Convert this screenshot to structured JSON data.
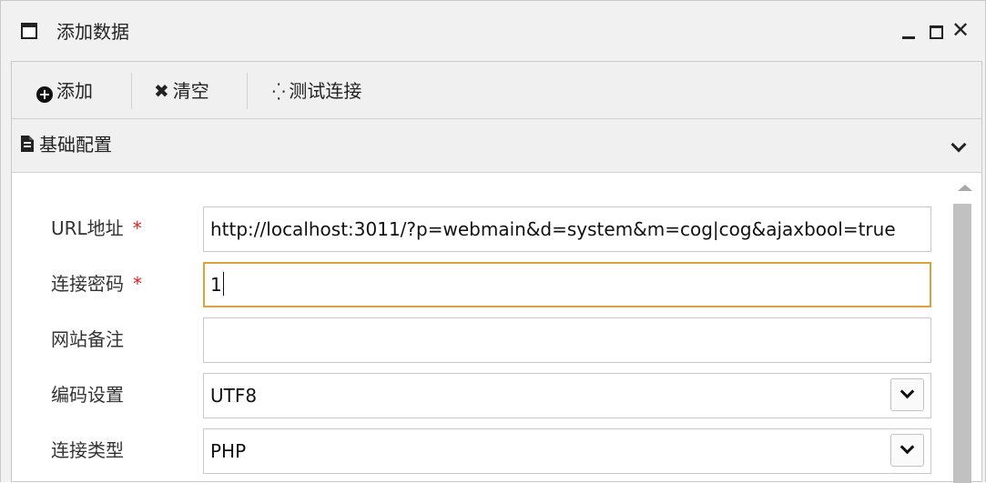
{
  "window": {
    "title": "添加数据"
  },
  "toolbar": {
    "add_label": "添加",
    "clear_label": "清空",
    "test_label": "测试连接"
  },
  "panel": {
    "title": "基础配置"
  },
  "form": {
    "url": {
      "label": "URL地址",
      "required_mark": "*",
      "value": "http://localhost:3011/?p=webmain&d=system&m=cog|cog&ajaxbool=true"
    },
    "password": {
      "label": "连接密码",
      "required_mark": "*",
      "value": "1"
    },
    "remark": {
      "label": "网站备注",
      "value": ""
    },
    "encoding": {
      "label": "编码设置",
      "value": "UTF8"
    },
    "conn_type": {
      "label": "连接类型",
      "value": "PHP"
    }
  },
  "icons": [
    "window-icon",
    "minimize-icon",
    "maximize-icon",
    "close-icon",
    "plus-circle-icon",
    "x-icon",
    "spinner-icon",
    "document-icon",
    "chevron-down-icon"
  ],
  "colors": {
    "focus_border": "#d9a23b",
    "required": "#e02020"
  }
}
